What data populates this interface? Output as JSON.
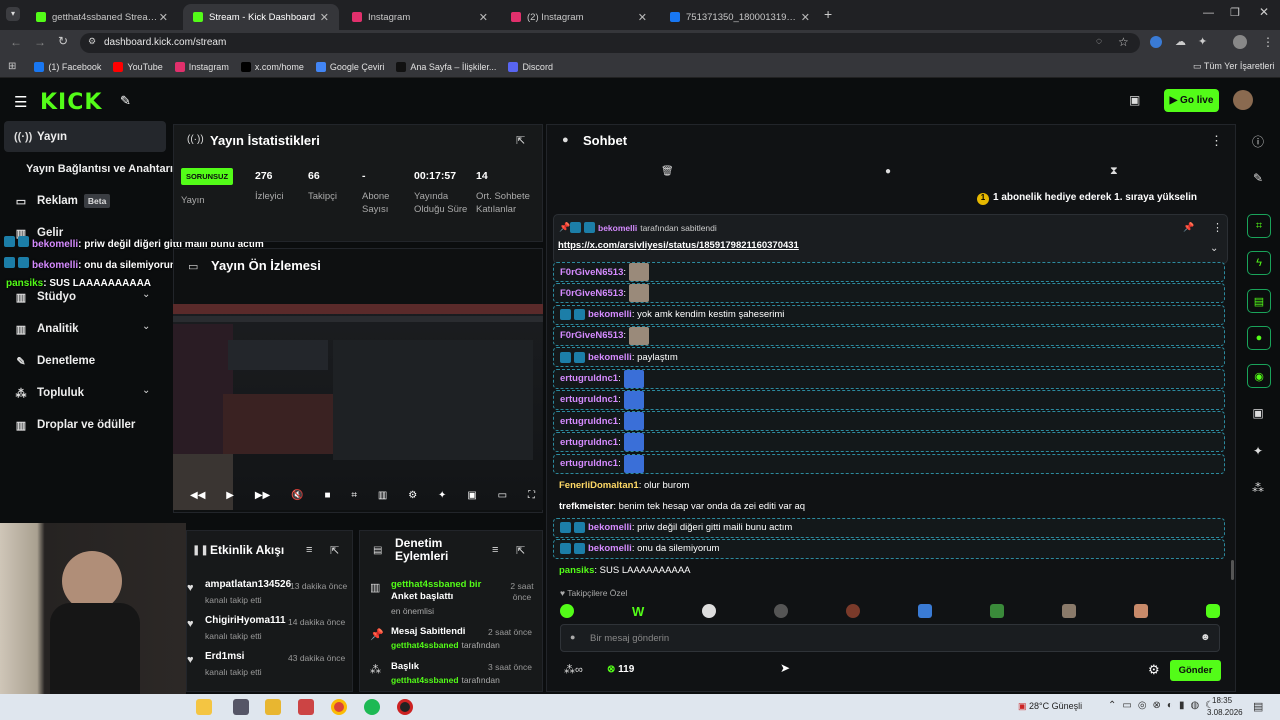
{
  "browser": {
    "tabs": [
      {
        "label": "getthat4ssbaned Stream - Wat",
        "color": "#53fc18"
      },
      {
        "label": "Stream - Kick Dashboard",
        "color": "#53fc18"
      },
      {
        "label": "Instagram",
        "color": "#e1306c"
      },
      {
        "label": "(2) Instagram",
        "color": "#e1306c"
      },
      {
        "label": "751371350_180001319879758...",
        "color": "#1877f2"
      }
    ],
    "new_tab": "+",
    "url": "dashboard.kick.com/stream",
    "bookmarks": [
      {
        "label": "(1) Facebook",
        "color": "#1877f2"
      },
      {
        "label": "YouTube",
        "color": "#ff0000"
      },
      {
        "label": "Instagram",
        "color": "#e1306c"
      },
      {
        "label": "x.com/home",
        "color": "#000000"
      },
      {
        "label": "Google Çeviri",
        "color": "#4285f4"
      },
      {
        "label": "Ana Sayfa – İlişkiler...",
        "color": "#111111"
      },
      {
        "label": "Discord",
        "color": "#5865f2"
      }
    ],
    "all_bookmarks": "Tüm Yer İşaretleri"
  },
  "kick": {
    "logo": "KICK",
    "go_live": "Go live",
    "accent": "#53fc18"
  },
  "sidebar": {
    "items": [
      {
        "label": "Yayın",
        "icon": "broadcast-icon"
      },
      {
        "label": "Yayın Bağlantısı ve Anahtarı",
        "icon": ""
      },
      {
        "label": "Reklam",
        "icon": "ad-icon",
        "badge": "Beta"
      },
      {
        "label": "Gelir",
        "icon": "money-icon"
      },
      {
        "label": "Stüdyo",
        "icon": "studio-icon"
      },
      {
        "label": "Analitik",
        "icon": "chart-icon"
      },
      {
        "label": "Denetleme",
        "icon": "wrench-icon"
      },
      {
        "label": "Topluluk",
        "icon": "people-icon"
      },
      {
        "label": "Droplar ve ödüller",
        "icon": "gift-icon"
      }
    ]
  },
  "overlay": {
    "lines": [
      {
        "user": "bekomelli",
        "text": ": priw değil diğeri gitti maili bunu actım"
      },
      {
        "user": "bekomelli",
        "text": ": onu da silemiyorum"
      },
      {
        "user": "pansiks",
        "text": ": SUS LAAAAAAAAAA"
      }
    ]
  },
  "stats": {
    "title": "Yayın İstatistikleri",
    "status_badge": "SORUNSUZ",
    "status_label": "Yayın",
    "items": [
      {
        "value": "276",
        "label": "İzleyici"
      },
      {
        "value": "66",
        "label": "Takipçi"
      },
      {
        "value": "-",
        "label": "Abone Sayısı"
      },
      {
        "value": "00:17:57",
        "label": "Yayında Olduğu Süre"
      },
      {
        "value": "14",
        "label": "Ort. Sohbete Katılanlar"
      }
    ]
  },
  "preview": {
    "title": "Yayın Ön İzlemesi"
  },
  "activity": {
    "title": "Etkinlik Akışı",
    "items": [
      {
        "user": "ampatlatan134526",
        "action": "kanalı takip etti",
        "time": "13 dakika önce"
      },
      {
        "user": "ChigiriHyoma111",
        "action": "kanalı takip etti",
        "time": "14 dakika önce"
      },
      {
        "user": "Erd1msi",
        "action": "kanalı takip etti",
        "time": "43 dakika önce"
      }
    ]
  },
  "moderation": {
    "title": "Denetim Eylemleri",
    "items": [
      {
        "line1": "getthat4ssbaned bir",
        "line2": "Anket başlattı",
        "sub": "en önemlisi",
        "time": "2 saat önce"
      },
      {
        "line1": "Mesaj Sabitlendi",
        "sub_user": "getthat4ssbaned",
        "sub": "tarafından",
        "time": "2 saat önce"
      },
      {
        "line1": "Başlık",
        "sub_user": "getthat4ssbaned",
        "sub": "tarafından",
        "time": "3 saat önce"
      }
    ]
  },
  "chat": {
    "title": "Sohbet",
    "gift_banner": "1 abonelik hediye ederek 1. sıraya yükselin",
    "pinned_by": "bekomelli",
    "pinned_by_suffix": "tarafından sabitlendi",
    "pinned_link": "https://x.com/arsivliyesi/status/1859179821160370431",
    "messages": [
      {
        "user": "F0rGiveN6513",
        "text": ":",
        "color": "#d58bff",
        "emote": true,
        "box": true,
        "badges": false
      },
      {
        "user": "F0rGiveN6513",
        "text": ":",
        "color": "#d58bff",
        "emote": true,
        "box": true,
        "badges": false
      },
      {
        "user": "bekomelli",
        "text": ": yok amk kendim kestim şaheserimi",
        "color": "#d58bff",
        "emote": false,
        "box": true,
        "badges": true
      },
      {
        "user": "F0rGiveN6513",
        "text": ":",
        "color": "#d58bff",
        "emote": true,
        "box": true,
        "badges": false
      },
      {
        "user": "bekomelli",
        "text": ": paylaştım",
        "color": "#d58bff",
        "emote": false,
        "box": true,
        "badges": true
      },
      {
        "user": "ertugruldnc1",
        "text": ":",
        "color": "#d58bff",
        "emote": true,
        "box": true,
        "badges": false
      },
      {
        "user": "ertugruldnc1",
        "text": ":",
        "color": "#d58bff",
        "emote": true,
        "box": true,
        "badges": false
      },
      {
        "user": "ertugruldnc1",
        "text": ":",
        "color": "#d58bff",
        "emote": true,
        "box": true,
        "badges": false
      },
      {
        "user": "ertugruldnc1",
        "text": ":",
        "color": "#d58bff",
        "emote": true,
        "box": true,
        "badges": false
      },
      {
        "user": "ertugruldnc1",
        "text": ":",
        "color": "#d58bff",
        "emote": true,
        "box": true,
        "badges": false
      },
      {
        "user": "FenerliDomaltan1",
        "text": ": olur burom",
        "color": "#ffd966",
        "emote": false,
        "box": false,
        "badges": false
      },
      {
        "user": "trefkmeister",
        "text": ": benim tek hesap var onda da zei editi var aq",
        "color": "#ffffff",
        "emote": false,
        "box": false,
        "badges": false
      },
      {
        "user": "bekomelli",
        "text": ": priw değil diğeri gitti maili bunu actım",
        "color": "#d58bff",
        "emote": false,
        "box": true,
        "badges": true
      },
      {
        "user": "bekomelli",
        "text": ": onu da silemiyorum",
        "color": "#d58bff",
        "emote": false,
        "box": true,
        "badges": true
      },
      {
        "user": "pansiks",
        "text": ": SUS LAAAAAAAAAA",
        "color": "#53fc18",
        "emote": false,
        "box": false,
        "badges": false
      }
    ],
    "emote_bar_label": "Takipçilere Özel",
    "input_placeholder": "Bir mesaj gönderin",
    "points": "119",
    "send": "Gönder"
  },
  "taskbar": {
    "weather": "28°C  Güneşli",
    "time": "18:35",
    "date": "3.08.2026"
  }
}
